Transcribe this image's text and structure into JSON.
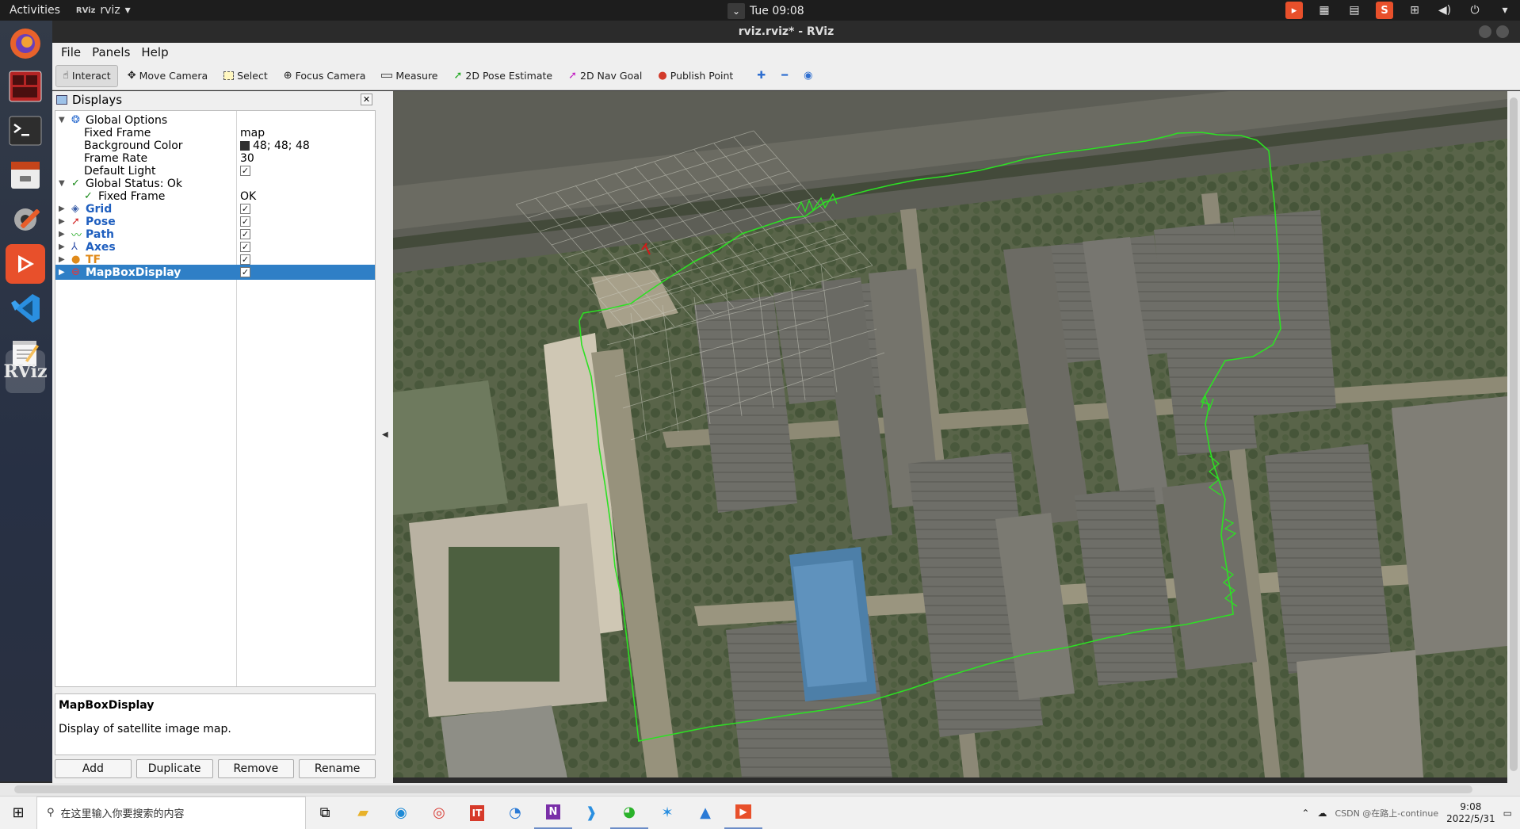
{
  "topbar": {
    "activities": "Activities",
    "app_name": "rviz",
    "app_badge": "RViz",
    "clock": "Tue 09:08"
  },
  "window": {
    "title": "rviz.rviz* - RViz"
  },
  "menu": [
    "File",
    "Panels",
    "Help"
  ],
  "toolbar": {
    "interact": "Interact",
    "move_camera": "Move Camera",
    "select": "Select",
    "focus_camera": "Focus Camera",
    "measure": "Measure",
    "pose_estimate": "2D Pose Estimate",
    "nav_goal": "2D Nav Goal",
    "publish_point": "Publish Point"
  },
  "displays": {
    "title": "Displays",
    "global_options": "Global Options",
    "fixed_frame_label": "Fixed Frame",
    "fixed_frame_value": "map",
    "bg_color_label": "Background Color",
    "bg_color_value": "48; 48; 48",
    "frame_rate_label": "Frame Rate",
    "frame_rate_value": "30",
    "default_light_label": "Default Light",
    "global_status": "Global Status: Ok",
    "status_fixed_frame": "Fixed Frame",
    "status_fixed_frame_value": "OK",
    "items": [
      {
        "name": "Grid",
        "checked": true
      },
      {
        "name": "Pose",
        "checked": true
      },
      {
        "name": "Path",
        "checked": true
      },
      {
        "name": "Axes",
        "checked": true
      },
      {
        "name": "TF",
        "checked": true
      },
      {
        "name": "MapBoxDisplay",
        "checked": true
      }
    ],
    "selected": "MapBoxDisplay",
    "description_title": "MapBoxDisplay",
    "description_text": "Display of satellite image map.",
    "buttons": [
      "Add",
      "Duplicate",
      "Remove",
      "Rename"
    ]
  },
  "taskbar": {
    "search_placeholder": "在这里输入你要搜索的内容",
    "time": "9:08",
    "date": "2022/5/31",
    "watermark": "CSDN @在路上-continue"
  },
  "colors": {
    "path": "#27e01f",
    "selection": "#2f7fc6",
    "background": "#303030"
  }
}
